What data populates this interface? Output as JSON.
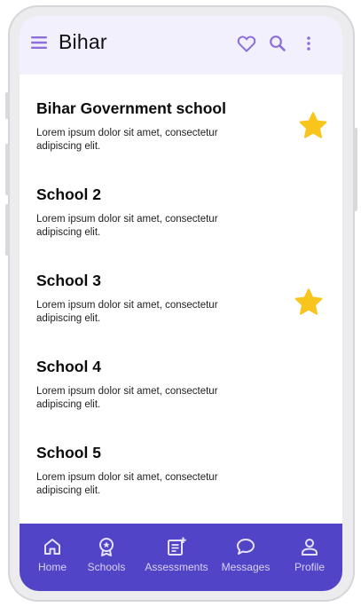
{
  "app_bar": {
    "title": "Bihar",
    "icons": [
      "menu-icon",
      "heart-icon",
      "search-icon",
      "more-vert-icon"
    ]
  },
  "schools": [
    {
      "name": "Bihar Government school",
      "description": "Lorem ipsum dolor sit amet, consectetur adipiscing elit.",
      "starred": true
    },
    {
      "name": "School 2",
      "description": "Lorem ipsum dolor sit amet, consectetur adipiscing elit.",
      "starred": false
    },
    {
      "name": "School 3",
      "description": "Lorem ipsum dolor sit amet, consectetur adipiscing elit.",
      "starred": true
    },
    {
      "name": "School 4",
      "description": "Lorem ipsum dolor sit amet, consectetur adipiscing elit.",
      "starred": false
    },
    {
      "name": "School 5",
      "description": "Lorem ipsum dolor sit amet, consectetur adipiscing elit.",
      "starred": false
    }
  ],
  "bottom_nav": {
    "items": [
      {
        "label": "Home",
        "icon": "home-icon"
      },
      {
        "label": "Schools",
        "icon": "badge-icon"
      },
      {
        "label": "Assessments",
        "icon": "note-add-icon"
      },
      {
        "label": "Messages",
        "icon": "chat-icon"
      },
      {
        "label": "Profile",
        "icon": "person-icon"
      }
    ]
  },
  "colors": {
    "accent": "#8c6fd8",
    "app_bar_bg": "#f3f0fd",
    "bottom_nav_bg": "#5244c7",
    "star": "#f9c51d"
  }
}
